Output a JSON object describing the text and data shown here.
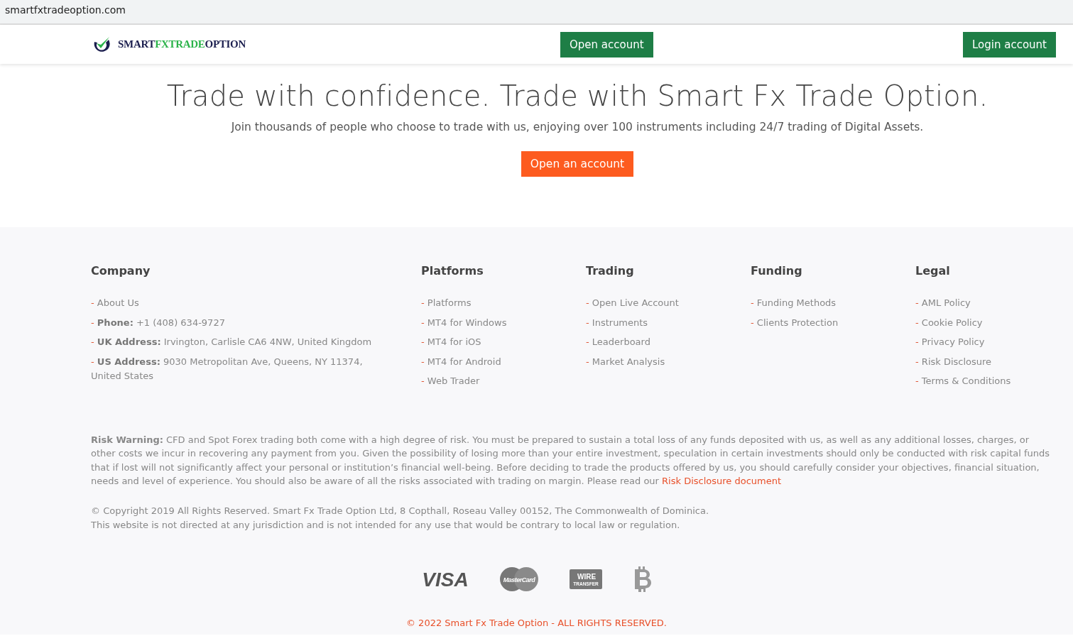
{
  "address_bar": {
    "url": "smartfxtradeoption.com"
  },
  "header": {
    "logo": {
      "parts": [
        {
          "text": "SMART",
          "color": "#1c1f4f"
        },
        {
          "text": "FXTRADE",
          "color": "#2bb34a"
        },
        {
          "text": "OPTION",
          "color": "#1c1f4f"
        }
      ]
    },
    "buttons": [
      "Open account",
      "Login account"
    ]
  },
  "hero": {
    "title": "Trade with confidence. Trade with Smart Fx Trade Option.",
    "subtitle": "Join thousands of people who choose to trade with us, enjoying over 100 instruments including 24/7 trading of Digital Assets.",
    "button": "Open an account"
  },
  "footer": {
    "columns": [
      {
        "heading": "Company",
        "items": [
          {
            "bullet": "-",
            "text": "About Us"
          },
          {
            "bullet": "-",
            "text": "**Phone:** +1 (408) 634-9727"
          },
          {
            "bullet": "-",
            "text": "**UK Address:** Irvington, Carlisle CA6 4NW, United Kingdom"
          },
          {
            "bullet": "-",
            "text": "**US Address:** 9030 Metropolitan Ave, Queens, NY 11374, United States"
          }
        ]
      },
      {
        "heading": "Platforms",
        "items": [
          {
            "bullet": "-",
            "text": "Platforms"
          },
          {
            "bullet": "-",
            "text": "MT4 for Windows"
          },
          {
            "bullet": "-",
            "text": "MT4 for iOS"
          },
          {
            "bullet": "-",
            "text": "MT4 for Android"
          },
          {
            "bullet": "-",
            "text": "Web Trader"
          }
        ]
      },
      {
        "heading": "Trading",
        "items": [
          {
            "bullet": "-",
            "text": "Open Live Account"
          },
          {
            "bullet": "-",
            "text": "Instruments"
          },
          {
            "bullet": "-",
            "text": "Leaderboard"
          },
          {
            "bullet": "-",
            "text": "Market Analysis"
          }
        ]
      },
      {
        "heading": "Funding",
        "items": [
          {
            "bullet": "-",
            "text": "Funding Methods"
          },
          {
            "bullet": "-",
            "text": "Clients Protection"
          }
        ]
      },
      {
        "heading": "Legal",
        "items": [
          {
            "bullet": "-",
            "text": "AML Policy"
          },
          {
            "bullet": "-",
            "text": "Cookie Policy"
          },
          {
            "bullet": "-",
            "text": "Privacy Policy"
          },
          {
            "bullet": "-",
            "text": "Risk Disclosure"
          },
          {
            "bullet": "-",
            "text": "Terms & Conditions"
          }
        ]
      }
    ],
    "risk_warning": {
      "text": "**Risk Warning:** CFD and Spot Forex trading both come with a high degree of risk. You must be prepared to sustain a total loss of any funds deposited with us, as well as any additional losses, charges, or other costs we incur in recovering any payment from you. Given the possibility of losing more than your entire investment, speculation in certain investments should only be conducted with risk capital funds that if lost will not significantly affect your personal or institution’s financial well-being. Before deciding to trade the products offered by us, you should carefully consider your objectives, financial situation, needs and level of experience. You should also be aware of all the risks associated with trading on margin. Please read our",
      "link": "Risk Disclosure document"
    },
    "copyright_lines": [
      "© Copyright 2019 All Rights Reserved. Smart Fx Trade Option Ltd, 8 Copthall, Roseau Valley 00152, The Commonwealth of Dominica.",
      "This website is not directed at any jurisdiction and is not intended for any use that would be contrary to local law or regulation."
    ],
    "payment_logos": [
      {
        "kind": "visa",
        "text": "VISA"
      },
      {
        "kind": "mastercard",
        "text": "MasterCard"
      },
      {
        "kind": "wire",
        "text": "WIRE TRANSFER"
      },
      {
        "kind": "bitcoin"
      }
    ],
    "bottom_line": "© 2022 Smart Fx Trade Option - ALL RIGHTS RESERVED."
  }
}
